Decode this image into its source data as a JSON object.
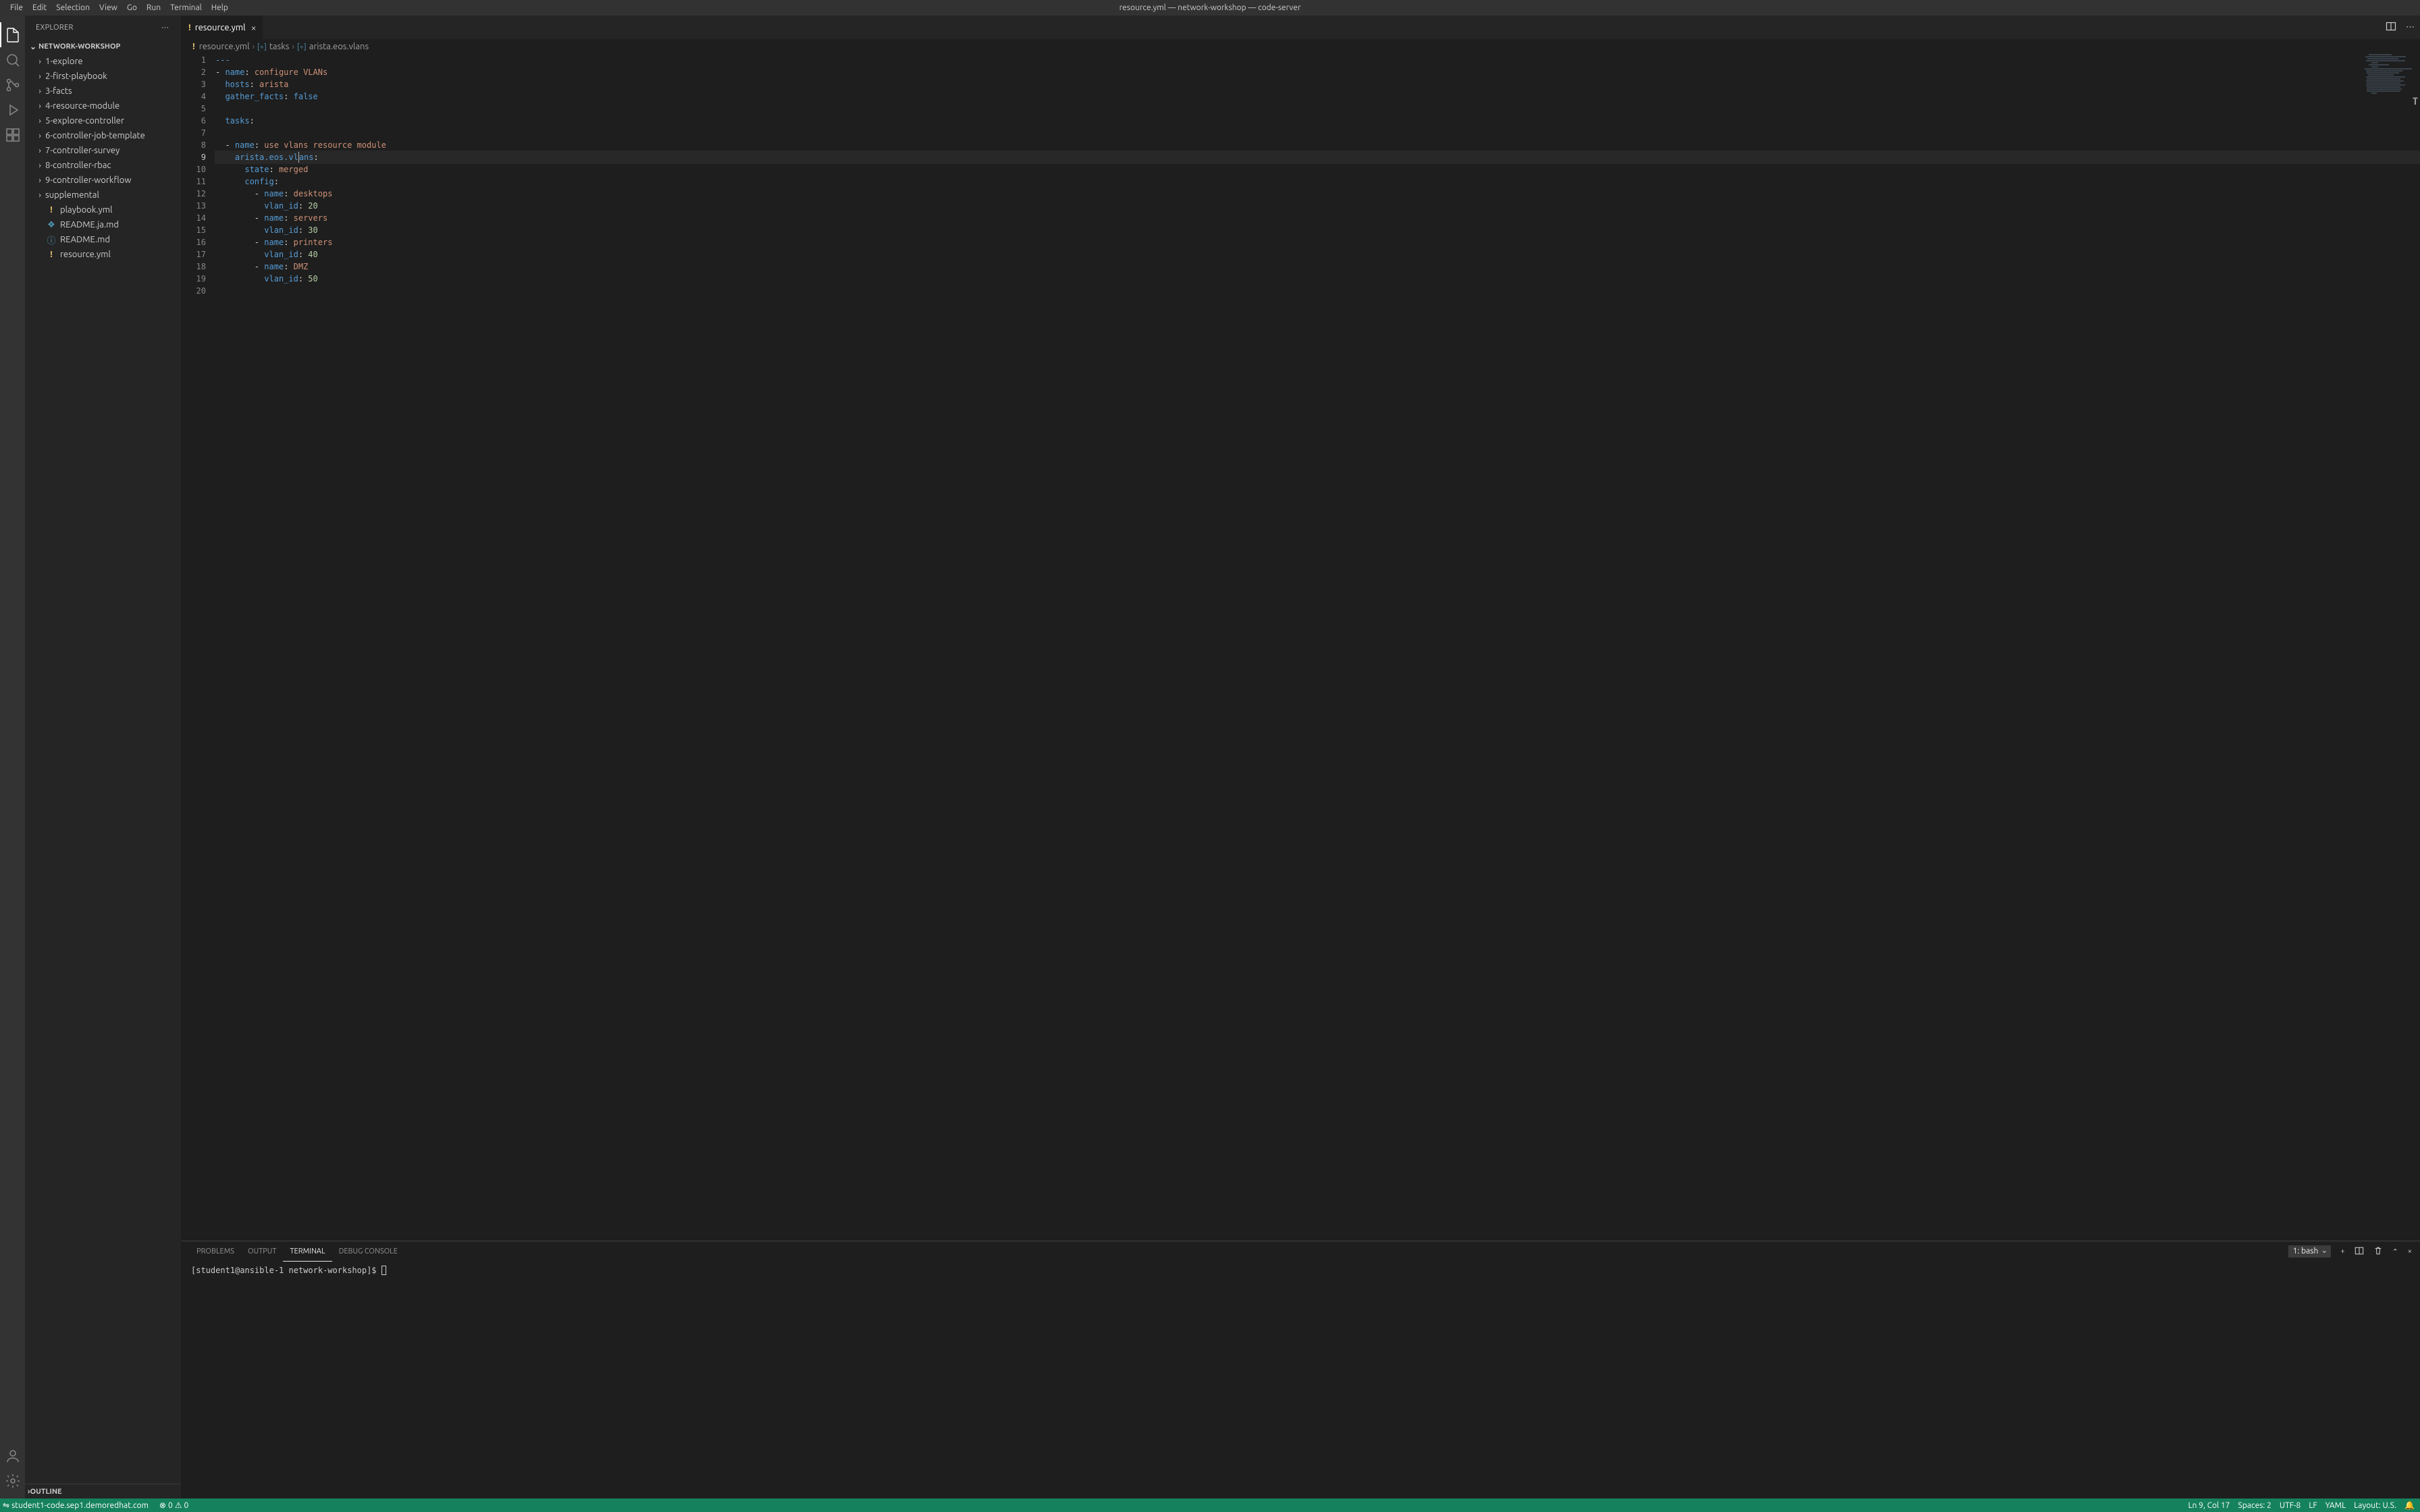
{
  "window": {
    "title": "resource.yml — network-workshop — code-server"
  },
  "menu": [
    "File",
    "Edit",
    "Selection",
    "View",
    "Go",
    "Run",
    "Terminal",
    "Help"
  ],
  "activity": {
    "items": [
      "explorer",
      "search",
      "source-control",
      "run-debug",
      "extensions"
    ],
    "bottom": [
      "account",
      "manage"
    ]
  },
  "sidebar": {
    "title": "EXPLORER",
    "actions_glyph": "⋯",
    "workspace": "NETWORK-WORKSHOP",
    "tree": [
      {
        "type": "folder",
        "label": "1-explore"
      },
      {
        "type": "folder",
        "label": "2-first-playbook"
      },
      {
        "type": "folder",
        "label": "3-facts"
      },
      {
        "type": "folder",
        "label": "4-resource-module"
      },
      {
        "type": "folder",
        "label": "5-explore-controller"
      },
      {
        "type": "folder",
        "label": "6-controller-job-template"
      },
      {
        "type": "folder",
        "label": "7-controller-survey"
      },
      {
        "type": "folder",
        "label": "8-controller-rbac"
      },
      {
        "type": "folder",
        "label": "9-controller-workflow"
      },
      {
        "type": "folder",
        "label": "supplemental"
      },
      {
        "type": "file",
        "label": "playbook.yml",
        "icon": "yml"
      },
      {
        "type": "file",
        "label": "README.ja.md",
        "icon": "md"
      },
      {
        "type": "file",
        "label": "README.md",
        "icon": "info"
      },
      {
        "type": "file",
        "label": "resource.yml",
        "icon": "yml"
      }
    ],
    "outline": "OUTLINE"
  },
  "tabs": {
    "open": [
      {
        "label": "resource.yml",
        "icon": "yml"
      }
    ],
    "close_glyph": "×"
  },
  "breadcrumbs": {
    "file": "resource.yml",
    "path": [
      "tasks",
      "arista.eos.vlans"
    ]
  },
  "editor": {
    "cursor_line": 9,
    "lines": [
      "---",
      "- name: configure VLANs",
      "  hosts: arista",
      "  gather_facts: false",
      "",
      "  tasks:",
      "",
      "  - name: use vlans resource module",
      "    arista.eos.vlans:",
      "      state: merged",
      "      config:",
      "        - name: desktops",
      "          vlan_id: 20",
      "        - name: servers",
      "          vlan_id: 30",
      "        - name: printers",
      "          vlan_id: 40",
      "        - name: DMZ",
      "          vlan_id: 50",
      ""
    ]
  },
  "panel": {
    "tabs": [
      "PROBLEMS",
      "OUTPUT",
      "TERMINAL",
      "DEBUG CONSOLE"
    ],
    "active": 2,
    "terminal": {
      "selector": "1: bash",
      "prompt": "[student1@ansible-1 network-workshop]$ "
    }
  },
  "status": {
    "remote_glyph": "⇋",
    "remote": "student1-code.sep1.demoredhat.com",
    "errors_glyph": "⊗",
    "errors": "0",
    "warnings_glyph": "⚠",
    "warnings": "0",
    "line_col": "Ln 9, Col 17",
    "spaces": "Spaces: 2",
    "encoding": "UTF-8",
    "eol": "LF",
    "lang": "YAML",
    "layout": "Layout: U.S.",
    "bell_glyph": "🔔"
  }
}
